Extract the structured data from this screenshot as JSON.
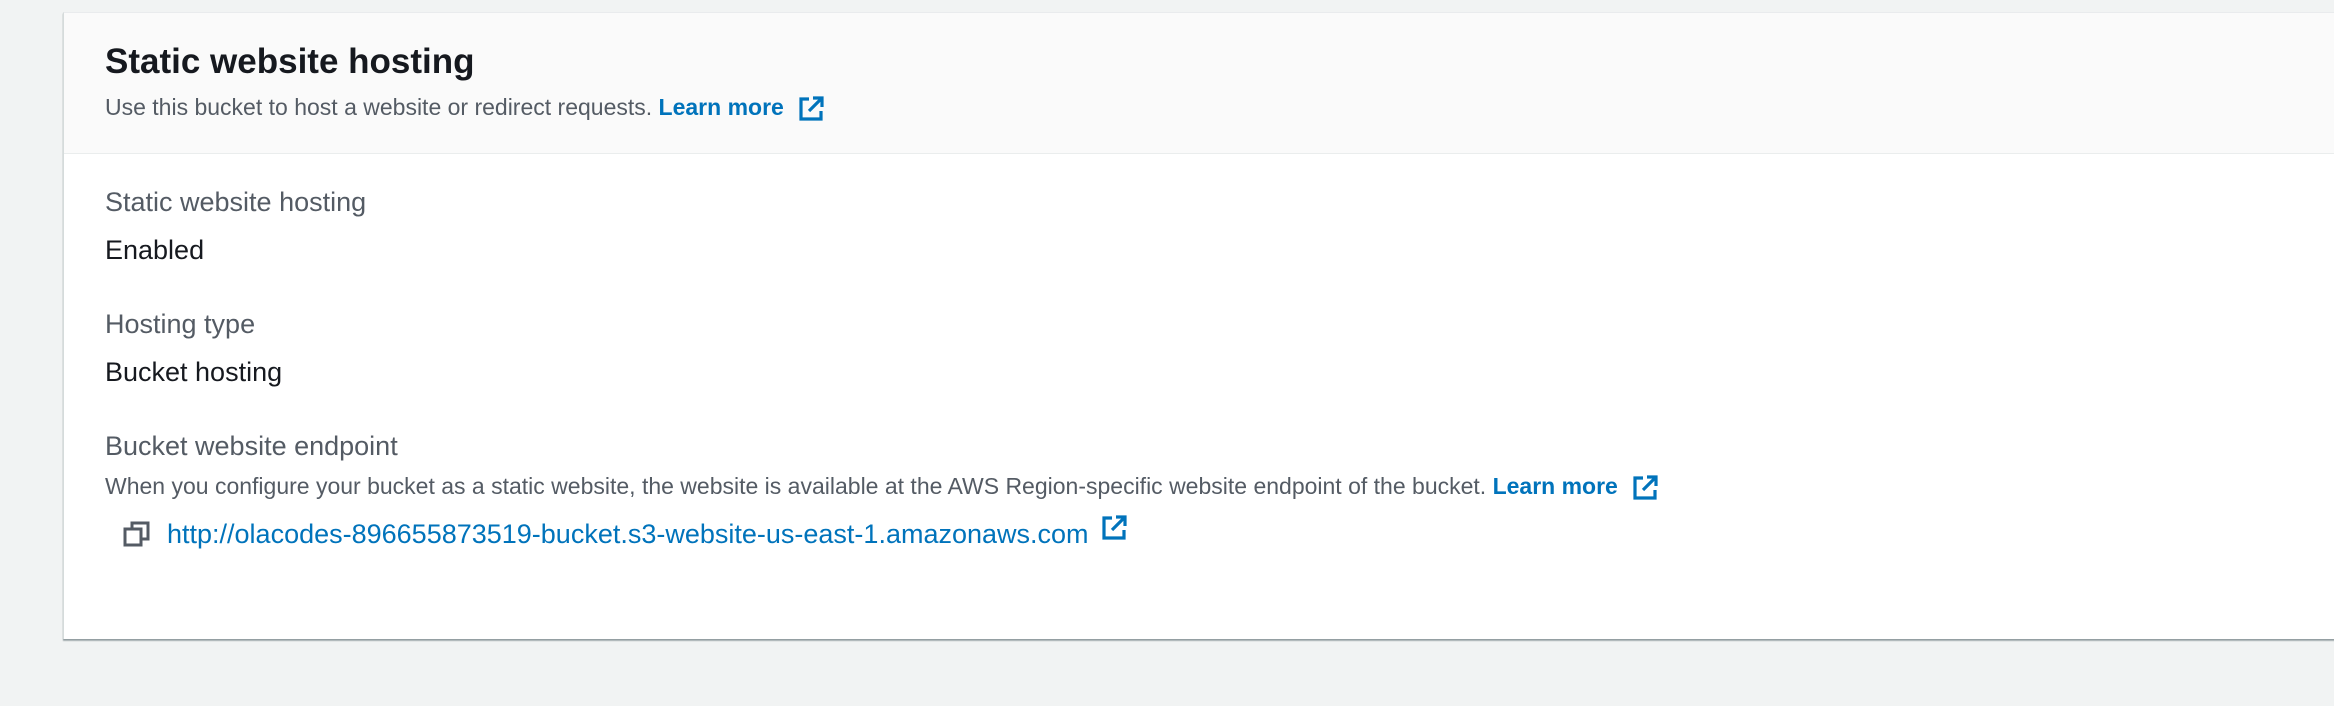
{
  "header": {
    "title": "Static website hosting",
    "description": "Use this bucket to host a website or redirect requests.",
    "learn_more": "Learn more"
  },
  "fields": {
    "hosting": {
      "label": "Static website hosting",
      "value": "Enabled"
    },
    "hosting_type": {
      "label": "Hosting type",
      "value": "Bucket hosting"
    },
    "endpoint": {
      "label": "Bucket website endpoint",
      "description": "When you configure your bucket as a static website, the website is available at the AWS Region-specific website endpoint of the bucket.",
      "learn_more": "Learn more",
      "url": "http://olacodes-896655873519-bucket.s3-website-us-east-1.amazonaws.com"
    }
  },
  "icons": {
    "external": "external-link-icon",
    "copy": "copy-icon"
  },
  "colors": {
    "link": "#0073bb",
    "text": "#16191f",
    "secondary_text": "#545b64",
    "background": "#f1f3f3"
  }
}
